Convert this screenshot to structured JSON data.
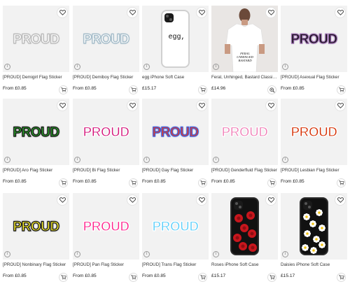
{
  "products": [
    {
      "title": "[PROUD] Demigirl Flag Sticker",
      "price": "From £0.85",
      "kind": "sticker",
      "sticker_text": "PROUD",
      "fill": "#ffffff",
      "outline": "#b7b7b7"
    },
    {
      "title": "[PROUD] Demiboy Flag Sticker",
      "price": "From £0.85",
      "kind": "sticker",
      "sticker_text": "PROUD",
      "fill": "#ffffff",
      "outline": "#9fb8c6"
    },
    {
      "title": "egg iPhone Soft Case",
      "price": "£15.17",
      "kind": "phone-white",
      "case_text": "egg,"
    },
    {
      "title": "Feral, Unhinged, Bastard Classic T-Shirt",
      "price": "£14.96",
      "kind": "tshirt",
      "tee_text": "FERAL UNHINGED BASTARD"
    },
    {
      "title": "[PROUD] Asexual Flag Sticker",
      "price": "From £0.85",
      "kind": "sticker",
      "sticker_text": "PROUD",
      "fill": "#111111",
      "outline": "#8e5ea3"
    },
    {
      "title": "[PROUD] Aro Flag Sticker",
      "price": "From £0.85",
      "kind": "sticker",
      "sticker_text": "PROUD",
      "fill": "#2ca02c",
      "outline": "#111111"
    },
    {
      "title": "[PROUD] Bi Flag Sticker",
      "price": "From £0.85",
      "kind": "sticker",
      "sticker_text": "PROUD",
      "fill": "#d4147a",
      "outline": "#ffffff"
    },
    {
      "title": "[PROUD] Gay Flag Sticker",
      "price": "From £0.85",
      "kind": "sticker",
      "sticker_text": "PROUD",
      "fill": "#e03c2b",
      "outline": "#3d5bd9"
    },
    {
      "title": "[PROUD] Genderfluid Flag Sticker",
      "price": "From £0.85",
      "kind": "sticker",
      "sticker_text": "PROUD",
      "fill": "#f07fb7",
      "outline": "#ffffff"
    },
    {
      "title": "[PROUD] Lesbian Flag Sticker",
      "price": "From £0.85",
      "kind": "sticker",
      "sticker_text": "PROUD",
      "fill": "#d52d00",
      "outline": "#ffffff"
    },
    {
      "title": "[PROUD] Nonbinary Flag Sticker",
      "price": "From £0.85",
      "kind": "sticker",
      "sticker_text": "PROUD",
      "fill": "#fff430",
      "outline": "#111111"
    },
    {
      "title": "[PROUD] Pan Flag Sticker",
      "price": "From £0.85",
      "kind": "sticker",
      "sticker_text": "PROUD",
      "fill": "#ff218c",
      "outline": "#ffffff"
    },
    {
      "title": "[PROUD] Trans Flag Sticker",
      "price": "From £0.85",
      "kind": "sticker",
      "sticker_text": "PROUD",
      "fill": "#5bcefa",
      "outline": "#ffffff"
    },
    {
      "title": "Roses iPhone Soft Case",
      "price": "£15.17",
      "kind": "phone-roses"
    },
    {
      "title": "Daisies iPhone Soft Case",
      "price": "£15.17",
      "kind": "phone-daisies"
    }
  ],
  "icons": {
    "heart": "heart-icon",
    "cart": "add-to-cart-icon",
    "zoom": "magnifier-icon",
    "info": "info-icon"
  }
}
